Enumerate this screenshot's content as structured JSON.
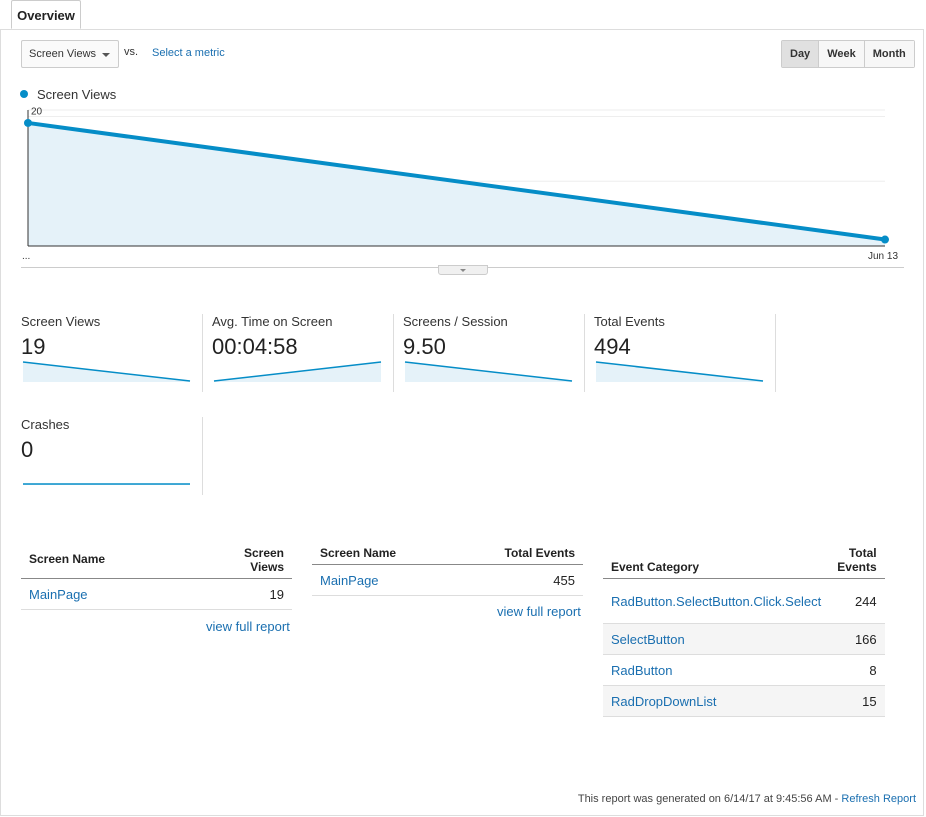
{
  "tab": {
    "label": "Overview"
  },
  "toolbar": {
    "metric_select": "Screen Views",
    "vs_label": "vs.",
    "select_metric_link": "Select a metric",
    "periods": [
      "Day",
      "Week",
      "Month"
    ],
    "active_period": "Day"
  },
  "chart_data": {
    "type": "area",
    "legend": "Screen Views",
    "color": "#058dc7",
    "fill": "#e5f2f9",
    "x_labels": [
      "...",
      "Jun 13"
    ],
    "y_ticks": [
      "20",
      "10"
    ],
    "ylim": [
      0,
      21
    ],
    "series": [
      {
        "name": "Screen Views",
        "values": [
          19,
          1
        ]
      }
    ],
    "grid": true
  },
  "scorecards": [
    {
      "title": "Screen Views",
      "value": "19",
      "trend": [
        19,
        1
      ]
    },
    {
      "title": "Avg. Time on Screen",
      "value": "00:04:58",
      "trend": [
        0,
        297
      ]
    },
    {
      "title": "Screens / Session",
      "value": "9.50",
      "trend": [
        9.5,
        0.5
      ]
    },
    {
      "title": "Total Events",
      "value": "494",
      "trend": [
        494,
        30
      ]
    },
    {
      "title": "Crashes",
      "value": "0",
      "trend": [
        0,
        0
      ]
    }
  ],
  "tables": {
    "screens": {
      "headers": [
        "Screen Name",
        "Screen Views"
      ],
      "rows": [
        [
          "MainPage",
          "19"
        ]
      ],
      "link": "view full report"
    },
    "screen_events": {
      "headers": [
        "Screen Name",
        "Total Events"
      ],
      "rows": [
        [
          "MainPage",
          "455"
        ]
      ],
      "link": "view full report"
    },
    "event_categories": {
      "headers": [
        "Event Category",
        "Total Events"
      ],
      "rows": [
        [
          "RadButton.SelectButton.Click.Select",
          "244"
        ],
        [
          "SelectButton",
          "166"
        ],
        [
          "RadButton",
          "8"
        ],
        [
          "RadDropDownList",
          "15"
        ]
      ]
    }
  },
  "footer": {
    "generated_text": "This report was generated on 6/14/17 at 9:45:56 AM - ",
    "refresh_link": "Refresh Report"
  }
}
